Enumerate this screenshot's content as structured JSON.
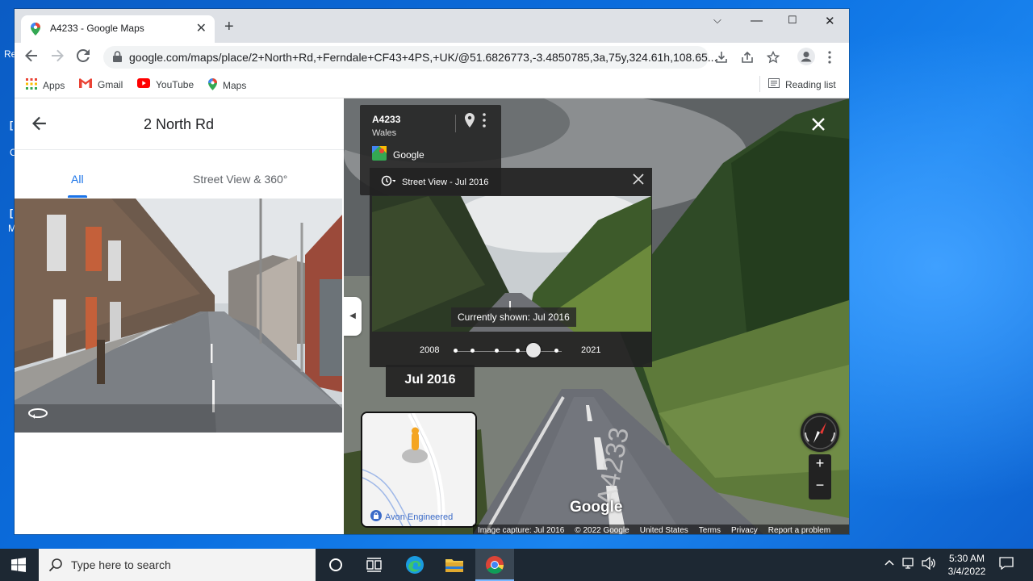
{
  "desktop": {
    "fragments": [
      "Re",
      "[",
      "C",
      "[",
      "M"
    ]
  },
  "tab": {
    "title": "A4233 - Google Maps",
    "close": "✕"
  },
  "newtab": "+",
  "window_controls": {
    "dropdown": "⌵",
    "minimize": "—",
    "maximize": "☐",
    "close": "✕"
  },
  "toolbar": {
    "url": "google.com/maps/place/2+North+Rd,+Ferndale+CF43+4PS,+UK/@51.6826773,-3.4850785,3a,75y,324.61h,108.65..."
  },
  "bookmarks": [
    {
      "label": "Apps",
      "icon": "apps-grid-icon"
    },
    {
      "label": "Gmail",
      "icon": "gmail-icon"
    },
    {
      "label": "YouTube",
      "icon": "youtube-icon"
    },
    {
      "label": "Maps",
      "icon": "maps-pin-icon"
    }
  ],
  "reading_list": "Reading list",
  "left_panel": {
    "title": "2 North Rd",
    "tabs": [
      "All",
      "Street View & 360°"
    ]
  },
  "infocard": {
    "road": "A4233",
    "region": "Wales",
    "source": "Google"
  },
  "time_panel": {
    "header": "Street View - Jul 2016",
    "currently_shown": "Currently shown: Jul 2016",
    "year_start": "2008",
    "year_end": "2021",
    "selected_fraction": 0.73
  },
  "date_pill": "Jul 2016",
  "minimap": {
    "label": "Avon Engineered"
  },
  "zoom": {
    "in": "+",
    "out": "−"
  },
  "google_logo": "Google",
  "footer": [
    "Image capture: Jul 2016",
    "© 2022 Google",
    "United States",
    "Terms",
    "Privacy",
    "Report a problem"
  ],
  "taskbar": {
    "search_placeholder": "Type here to search",
    "time": "5:30 AM",
    "date": "3/4/2022"
  },
  "colors": {
    "accent": "#1a73e8",
    "taskbar": "#1d2833",
    "desktop": "#0b6fe0"
  }
}
